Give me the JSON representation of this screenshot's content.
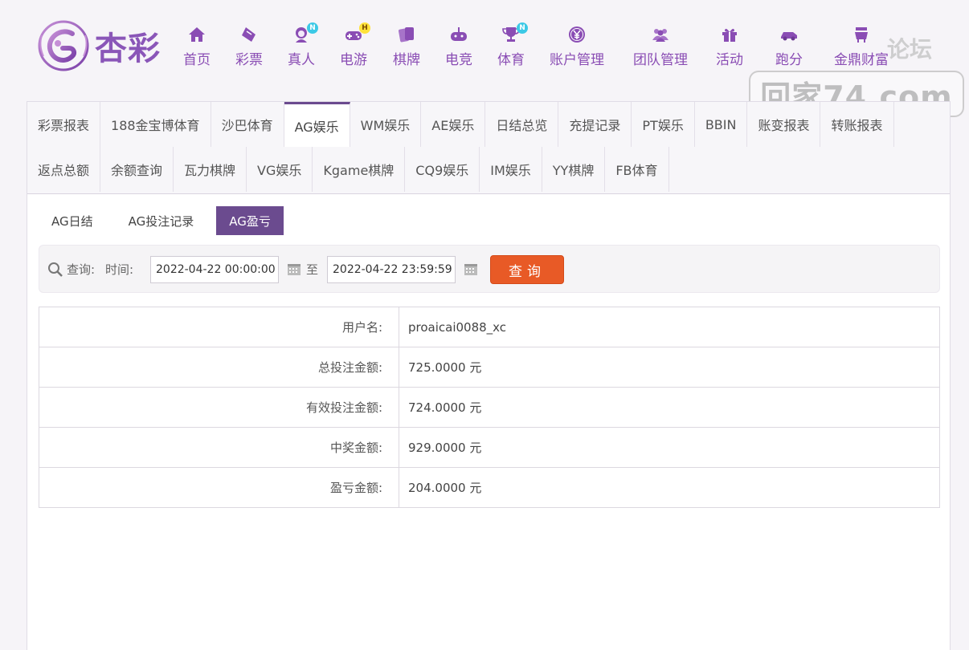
{
  "brand": {
    "name": "杏彩",
    "primary": "#8a4db4",
    "accent": "#6b4b8f",
    "button": "#e85a26"
  },
  "nav": [
    {
      "label": "首页",
      "icon": "home-icon",
      "badge": ""
    },
    {
      "label": "彩票",
      "icon": "ticket-icon",
      "badge": ""
    },
    {
      "label": "真人",
      "icon": "lady-icon",
      "badge": "N"
    },
    {
      "label": "电游",
      "icon": "gamepad-icon",
      "badge": "H"
    },
    {
      "label": "棋牌",
      "icon": "cards-icon",
      "badge": ""
    },
    {
      "label": "电竞",
      "icon": "joystick-icon",
      "badge": ""
    },
    {
      "label": "体育",
      "icon": "trophy-icon",
      "badge": "N"
    },
    {
      "label": "账户管理",
      "icon": "yen-icon",
      "badge": ""
    },
    {
      "label": "团队管理",
      "icon": "team-icon",
      "badge": ""
    },
    {
      "label": "活动",
      "icon": "gift-icon",
      "badge": ""
    },
    {
      "label": "跑分",
      "icon": "car-icon",
      "badge": ""
    },
    {
      "label": "金鼎财富",
      "icon": "ding-icon",
      "badge": ""
    }
  ],
  "watermark": {
    "forum": "论坛",
    "site": "回家74.com"
  },
  "tabs_row1": [
    "彩票报表",
    "188金宝博体育",
    "沙巴体育",
    "AG娱乐",
    "WM娱乐",
    "AE娱乐",
    "日结总览",
    "充提记录",
    "PT娱乐",
    "BBIN",
    "账变报表",
    "转账报表"
  ],
  "tabs_row2": [
    "返点总额",
    "余额查询",
    "瓦力棋牌",
    "VG娱乐",
    "Kgame棋牌",
    "CQ9娱乐",
    "IM娱乐",
    "YY棋牌",
    "FB体育"
  ],
  "active_tab": "AG娱乐",
  "sub_tabs": [
    "AG日结",
    "AG投注记录",
    "AG盈亏"
  ],
  "active_sub_tab": "AG盈亏",
  "query": {
    "label": "查询:",
    "time_label": "时间:",
    "from": "2022-04-22 00:00:00",
    "to_label": "至",
    "to": "2022-04-22 23:59:59",
    "button": "查询"
  },
  "result": [
    {
      "key": "用户名:",
      "value": "proaicai0088_xc"
    },
    {
      "key": "总投注金额:",
      "value": "725.0000 元"
    },
    {
      "key": "有效投注金额:",
      "value": "724.0000 元"
    },
    {
      "key": "中奖金额:",
      "value": "929.0000 元"
    },
    {
      "key": "盈亏金额:",
      "value": "204.0000 元"
    }
  ]
}
